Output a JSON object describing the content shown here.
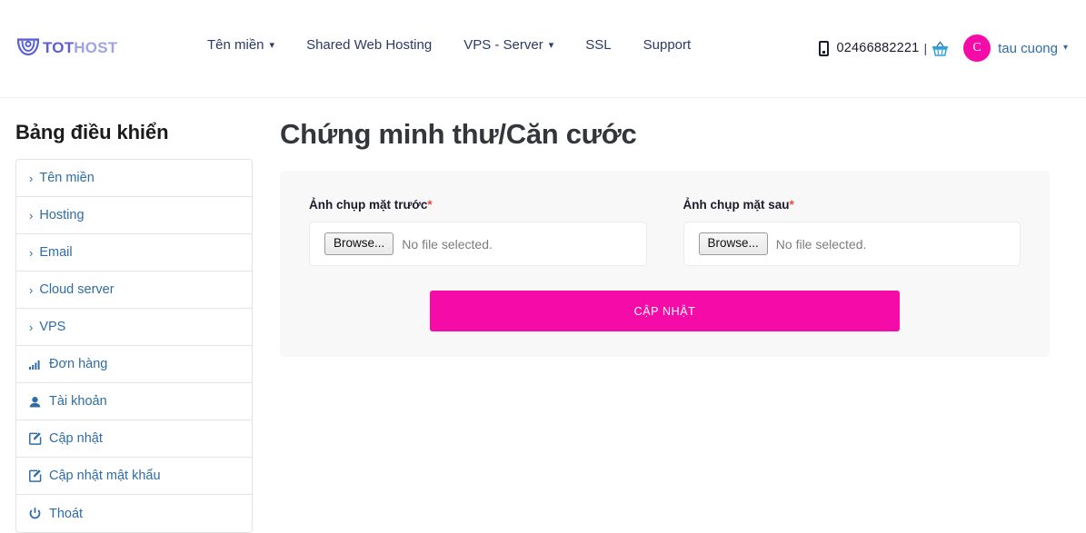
{
  "header": {
    "logo": {
      "icon": "tothost-shield-icon",
      "part1": "TOT",
      "part2": "HOST"
    },
    "nav": [
      {
        "label": "Tên miền",
        "caret": "▾",
        "has_caret": true
      },
      {
        "label": "Shared Web Hosting",
        "caret": "",
        "has_caret": false
      },
      {
        "label": "VPS - Server",
        "caret": "▾",
        "has_caret": true
      },
      {
        "label": "SSL",
        "caret": "",
        "has_caret": false
      },
      {
        "label": "Support",
        "caret": "",
        "has_caret": false
      }
    ],
    "phone_icon": "mobile-phone-icon",
    "phone": "02466882221",
    "separator": "|",
    "cart_icon": "shopping-basket-icon",
    "avatar_initial": "C",
    "avatar_color": "#f50ca8",
    "username": "tau cuong",
    "username_caret": "▾"
  },
  "sidebar": {
    "title": "Bảng điều khiển",
    "items": [
      {
        "label": "Tên miền",
        "icon": "chevron-right-icon",
        "marker": "›"
      },
      {
        "label": "Hosting",
        "icon": "chevron-right-icon",
        "marker": "›"
      },
      {
        "label": "Email",
        "icon": "chevron-right-icon",
        "marker": "›"
      },
      {
        "label": "Cloud server",
        "icon": "chevron-right-icon",
        "marker": "›"
      },
      {
        "label": "VPS",
        "icon": "chevron-right-icon",
        "marker": "›"
      },
      {
        "label": "Đơn hàng",
        "icon": "signal-bars-icon",
        "marker": ""
      },
      {
        "label": "Tài khoản",
        "icon": "user-icon",
        "marker": ""
      },
      {
        "label": "Cập nhật",
        "icon": "edit-pencil-square-icon",
        "marker": ""
      },
      {
        "label": "Cập nhật mật khẩu",
        "icon": "edit-pencil-square-icon",
        "marker": ""
      },
      {
        "label": "Thoát",
        "icon": "power-off-icon",
        "marker": ""
      }
    ]
  },
  "main": {
    "title": "Chứng minh thư/Căn cước",
    "fields": [
      {
        "label": "Ảnh chụp mặt trước",
        "required_mark": "*",
        "browse_label": "Browse...",
        "file_status": "No file selected."
      },
      {
        "label": "Ảnh chụp mặt sau",
        "required_mark": "*",
        "browse_label": "Browse...",
        "file_status": "No file selected."
      }
    ],
    "submit_label": "CẬP NHẬT",
    "submit_color": "#f50ca8"
  }
}
